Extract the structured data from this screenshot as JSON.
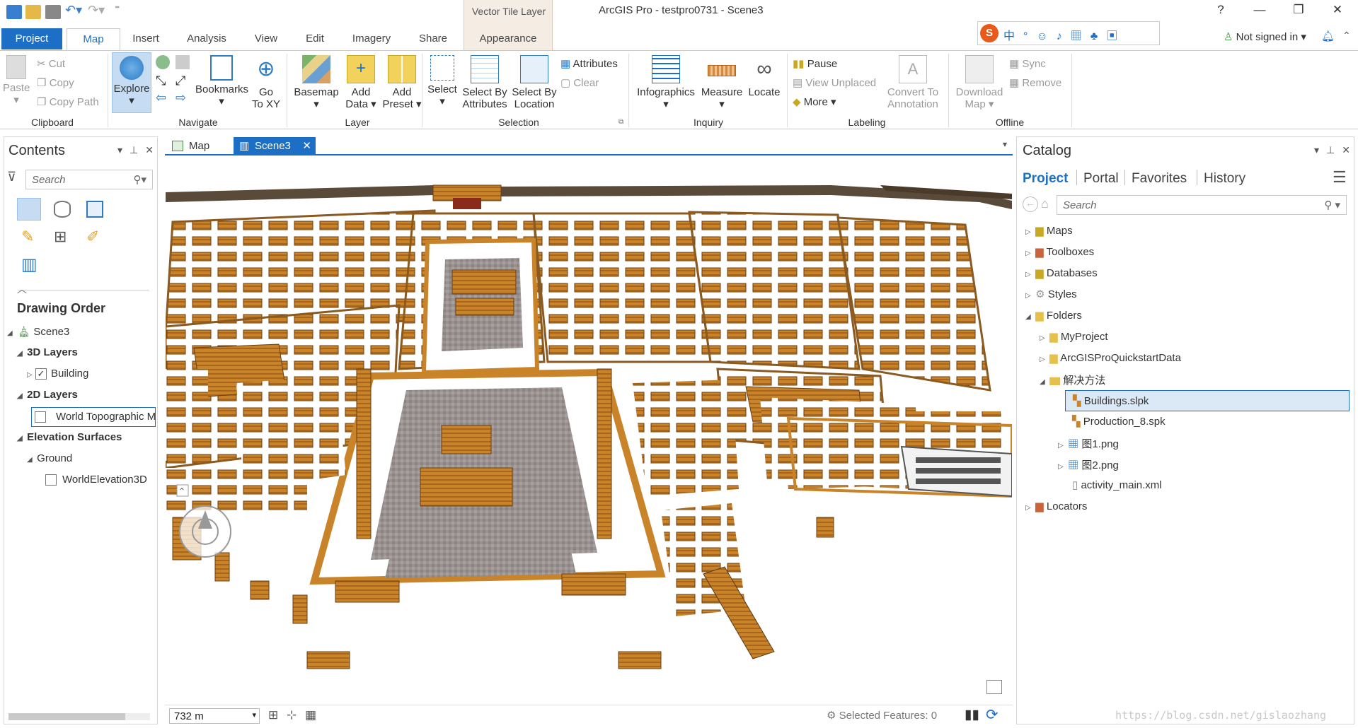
{
  "window": {
    "title": "ArcGIS Pro - testpro0731 - Scene3",
    "contextual_group": "Vector Tile Layer",
    "help": "?",
    "minimize": "—",
    "restore": "❐",
    "close": "✕"
  },
  "tabs": [
    "Project",
    "Map",
    "Insert",
    "Analysis",
    "View",
    "Edit",
    "Imagery",
    "Share",
    "Appearance"
  ],
  "account": {
    "label": "Not signed in ▾"
  },
  "ribbon": {
    "clipboard": {
      "paste": "Paste",
      "cut": "Cut",
      "copy": "Copy",
      "copy_path": "Copy Path",
      "group": "Clipboard"
    },
    "navigate": {
      "explore": "Explore",
      "bookmarks": "Bookmarks",
      "go_to_xy_1": "Go",
      "go_to_xy_2": "To XY",
      "group": "Navigate"
    },
    "layer": {
      "basemap": "Basemap",
      "add_data_1": "Add",
      "add_data_2": "Data ▾",
      "add_preset_1": "Add",
      "add_preset_2": "Preset ▾",
      "group": "Layer"
    },
    "selection": {
      "select": "Select",
      "select_by_attr_1": "Select By",
      "select_by_attr_2": "Attributes",
      "select_by_loc_1": "Select By",
      "select_by_loc_2": "Location",
      "attributes": "Attributes",
      "clear": "Clear",
      "group": "Selection"
    },
    "inquiry": {
      "infographics": "Infographics",
      "measure": "Measure",
      "locate": "Locate",
      "group": "Inquiry"
    },
    "labeling": {
      "pause": "Pause",
      "view_unplaced": "View Unplaced",
      "more": "More ▾",
      "convert_1": "Convert To",
      "convert_2": "Annotation",
      "group": "Labeling"
    },
    "offline": {
      "download_1": "Download",
      "download_2": "Map ▾",
      "sync": "Sync",
      "remove": "Remove",
      "group": "Offline"
    }
  },
  "contents": {
    "title": "Contents",
    "search_placeholder": "Search",
    "drawing_order": "Drawing Order",
    "tree": {
      "scene": "Scene3",
      "layers_3d": "3D Layers",
      "building": "Building",
      "layers_2d": "2D Layers",
      "world_topo": "World Topographic Map",
      "elevation": "Elevation Surfaces",
      "ground": "Ground",
      "world_elev": "WorldElevation3D"
    }
  },
  "views": {
    "map_tab": "Map",
    "scene_tab": "Scene3",
    "close": "✕"
  },
  "status": {
    "scale": "732 m",
    "selected": "Selected Features: 0"
  },
  "catalog": {
    "title": "Catalog",
    "tabs": [
      "Project",
      "Portal",
      "Favorites",
      "History"
    ],
    "search_placeholder": "Search",
    "items": {
      "maps": "Maps",
      "toolboxes": "Toolboxes",
      "databases": "Databases",
      "styles": "Styles",
      "folders": "Folders",
      "myproject": "MyProject",
      "quickstart": "ArcGISProQuickstartData",
      "solution": "解决方法",
      "buildings": "Buildings.slpk",
      "production": "Production_8.spk",
      "fig1": "图1.png",
      "fig2": "图2.png",
      "xml": "activity_main.xml",
      "locators": "Locators"
    }
  },
  "watermark": "https://blog.csdn.net/gislaozhang",
  "colors": {
    "accent": "#1d6fc6",
    "roof": "#c9842a",
    "roof_dark": "#7a4a14",
    "pavement": "#9a9290",
    "wall": "#5a3a24"
  }
}
